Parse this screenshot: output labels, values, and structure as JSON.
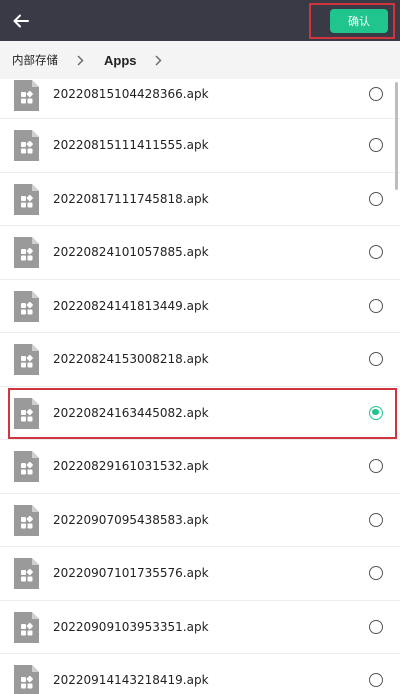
{
  "header": {
    "confirm_label": "确认"
  },
  "breadcrumb": {
    "items": [
      "内部存储",
      "Apps"
    ]
  },
  "files": [
    {
      "name": "20220815104428366.apk",
      "selected": false
    },
    {
      "name": "20220815111411555.apk",
      "selected": false
    },
    {
      "name": "20220817111745818.apk",
      "selected": false
    },
    {
      "name": "20220824101057885.apk",
      "selected": false
    },
    {
      "name": "20220824141813449.apk",
      "selected": false
    },
    {
      "name": "20220824153008218.apk",
      "selected": false
    },
    {
      "name": "20220824163445082.apk",
      "selected": true
    },
    {
      "name": "20220829161031532.apk",
      "selected": false
    },
    {
      "name": "20220907095438583.apk",
      "selected": false
    },
    {
      "name": "20220907101735576.apk",
      "selected": false
    },
    {
      "name": "20220909103953351.apk",
      "selected": false
    },
    {
      "name": "20220914143218419.apk",
      "selected": false
    }
  ],
  "colors": {
    "topbar": "#3a3a47",
    "accent": "#1fc58c",
    "highlight_outline": "#d0343c",
    "file_icon": "#9a9a9a"
  }
}
